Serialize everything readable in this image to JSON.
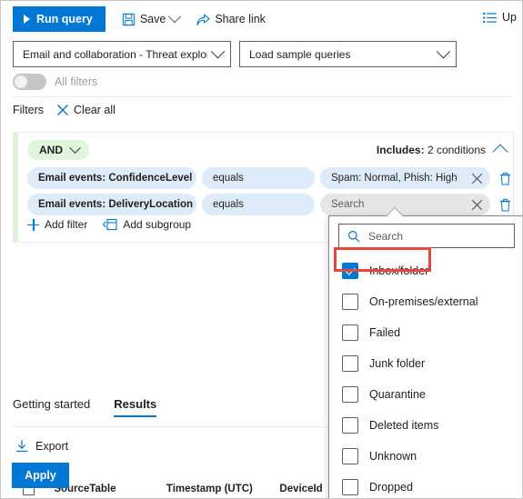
{
  "toolbar": {
    "run_query": "Run query",
    "save": "Save",
    "share_link": "Share link",
    "right_action": "Up"
  },
  "selects": {
    "schema": "Email and collaboration - Threat explorer",
    "sample_queries": "Load sample queries"
  },
  "all_filters": {
    "label": "All filters",
    "state": "off"
  },
  "filters_header": {
    "title": "Filters",
    "clear_all": "Clear all"
  },
  "filter_group": {
    "operator": "AND",
    "includes_label": "Includes:",
    "includes_value": "2 conditions",
    "rows": [
      {
        "field": "Email events: ConfidenceLevel",
        "operator": "equals",
        "value": "Spam: Normal, Phish: High",
        "is_placeholder": false
      },
      {
        "field": "Email events: DeliveryLocation",
        "operator": "equals",
        "value": "Search",
        "is_placeholder": true
      }
    ],
    "add_filter": "Add filter",
    "add_subgroup": "Add subgroup"
  },
  "dropdown": {
    "search_placeholder": "Search",
    "options": [
      {
        "label": "Inbox/folder",
        "checked": true
      },
      {
        "label": "On-premises/external",
        "checked": false
      },
      {
        "label": "Failed",
        "checked": false
      },
      {
        "label": "Junk folder",
        "checked": false
      },
      {
        "label": "Quarantine",
        "checked": false
      },
      {
        "label": "Deleted items",
        "checked": false
      },
      {
        "label": "Unknown",
        "checked": false
      },
      {
        "label": "Dropped",
        "checked": false
      }
    ],
    "apply": "Apply"
  },
  "tabs": [
    {
      "label": "Getting started",
      "active": false
    },
    {
      "label": "Results",
      "active": true
    }
  ],
  "results": {
    "export": "Export",
    "columns": [
      "SourceTable",
      "Timestamp (UTC)",
      "DeviceId"
    ]
  },
  "colors": {
    "accent": "#0078d4",
    "pill_blue": "#deecf9",
    "pill_green": "#dff6dd",
    "highlight_red": "#e8483c",
    "placeholder_gray": "#e6e6e6"
  }
}
